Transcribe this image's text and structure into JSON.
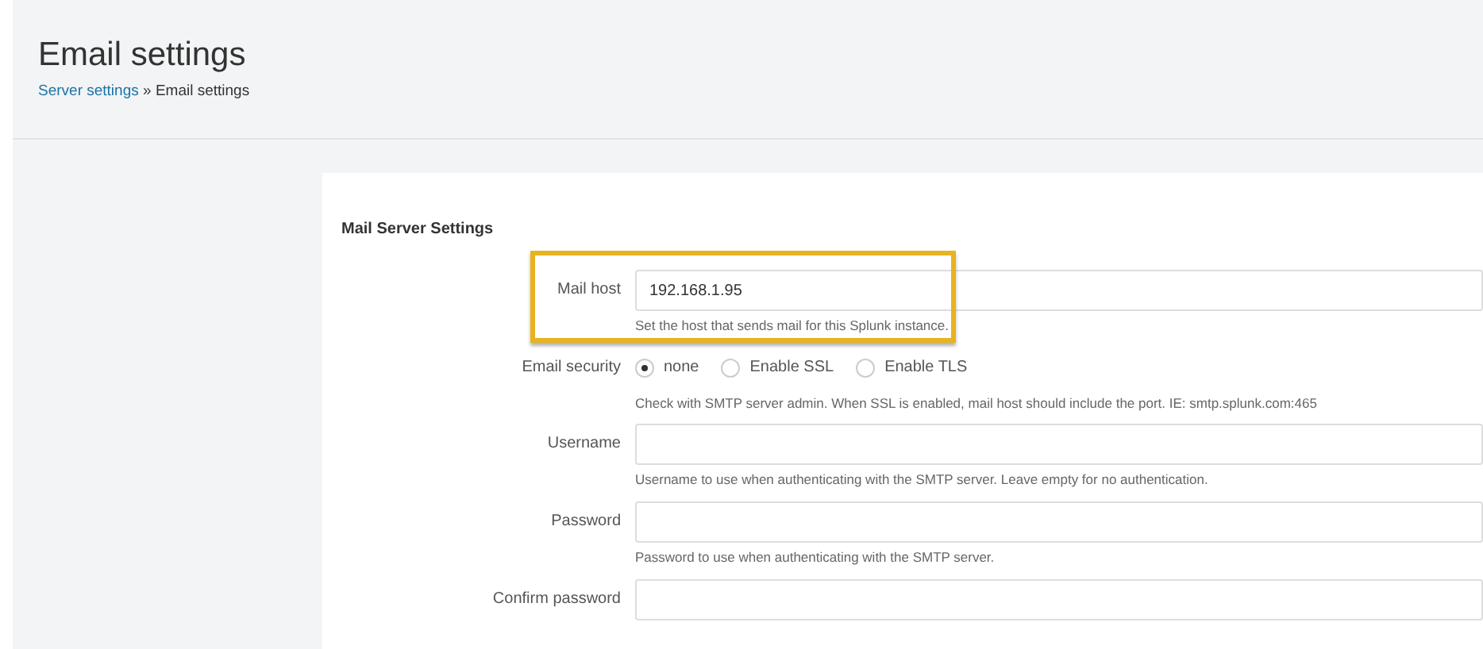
{
  "header": {
    "title": "Email settings",
    "breadcrumb": [
      {
        "label": "Server settings",
        "link": true
      },
      {
        "label": "Email settings",
        "link": false
      }
    ],
    "separator": "»"
  },
  "section": {
    "title": "Mail Server Settings"
  },
  "fields": [
    {
      "kind": "text",
      "label": "Mail host",
      "value": "192.168.1.95",
      "help": "Set the host that sends mail for this Splunk instance.",
      "highlighted": true
    },
    {
      "kind": "radio",
      "label": "Email security",
      "options": [
        {
          "label": "none",
          "selected": true
        },
        {
          "label": "Enable SSL",
          "selected": false
        },
        {
          "label": "Enable TLS",
          "selected": false
        }
      ],
      "help": "Check with SMTP server admin. When SSL is enabled, mail host should include the port. IE: smtp.splunk.com:465",
      "highlighted": false
    },
    {
      "kind": "text",
      "label": "Username",
      "help": "Username to use when authenticating with the SMTP server. Leave empty for no authentication.",
      "highlighted": false
    },
    {
      "kind": "text",
      "label": "Password",
      "help": "Password to use when authenticating with the SMTP server.",
      "highlighted": false
    },
    {
      "kind": "text",
      "label": "Confirm password",
      "highlighted": false
    }
  ]
}
